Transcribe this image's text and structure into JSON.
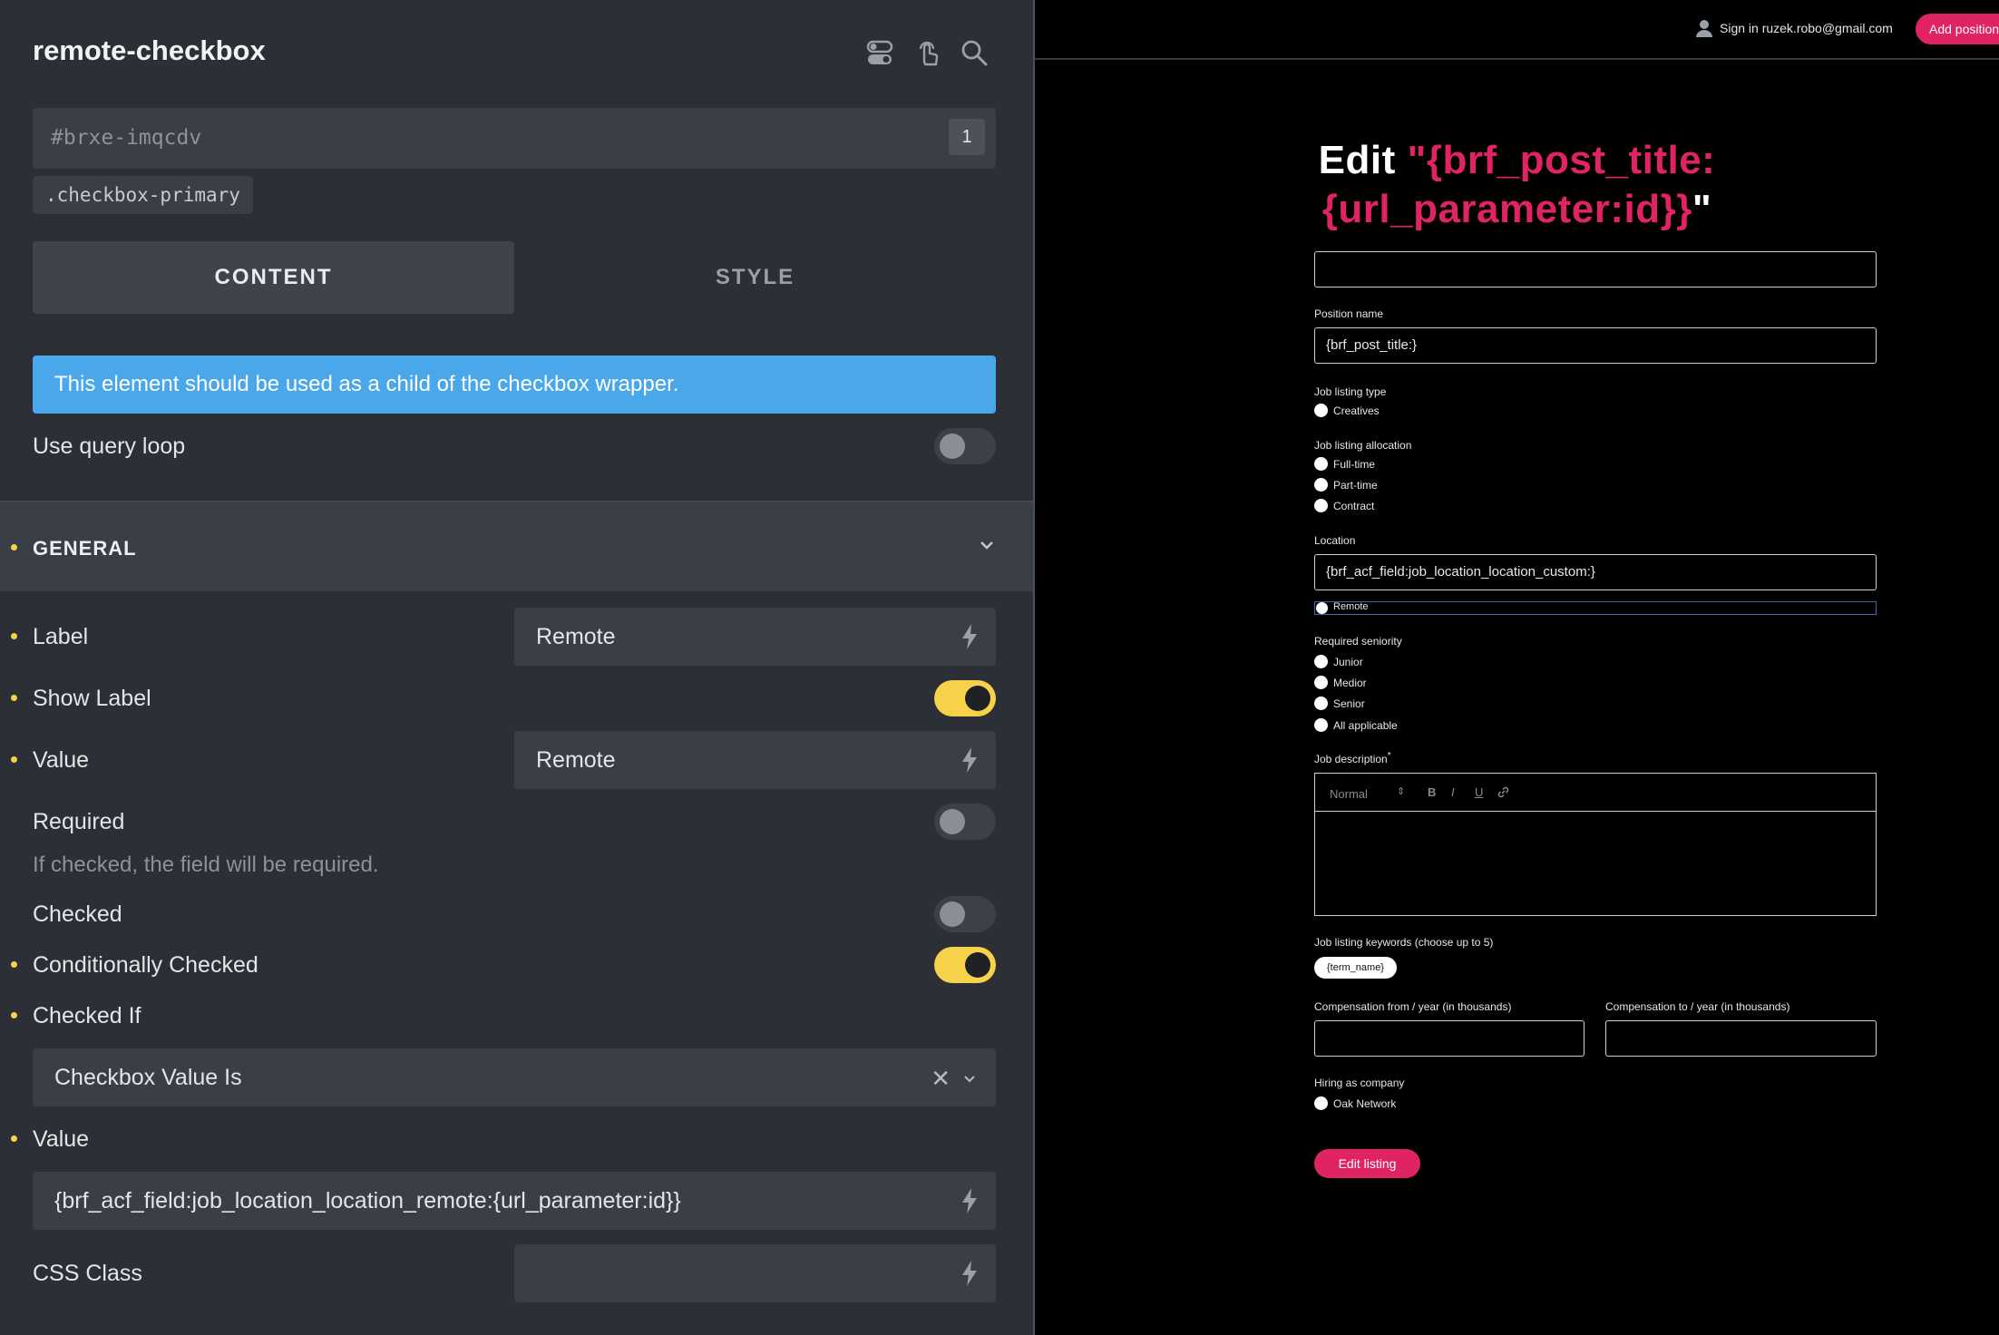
{
  "panel": {
    "title": "remote-checkbox",
    "element_id": "#brxe-imqcdv",
    "id_count": "1",
    "class_chip": ".checkbox-primary",
    "tabs": {
      "content": "CONTENT",
      "style": "STYLE"
    },
    "notice": "This element should be used as a child of the checkbox wrapper.",
    "use_query_loop": "Use query loop",
    "general_title": "GENERAL",
    "label_label": "Label",
    "label_value": "Remote",
    "show_label": "Show Label",
    "value_label": "Value",
    "value_value": "Remote",
    "required_label": "Required",
    "required_hint": "If checked, the field will be required.",
    "checked_label": "Checked",
    "cond_checked_label": "Conditionally Checked",
    "checked_if_label": "Checked If",
    "checked_if_value": "Checkbox Value Is",
    "value2_label": "Value",
    "value2_value": "{brf_acf_field:job_location_location_remote:{url_parameter:id}}",
    "css_class_label": "CSS Class",
    "css_class_value": "",
    "toggles": {
      "use_query_loop": false,
      "show_label": true,
      "required": false,
      "checked": false,
      "conditionally_checked": true
    },
    "accent_color": "#f6d24a",
    "notice_color": "#4aa8ea"
  },
  "preview": {
    "signin": "Sign in ruzek.robo@gmail.com",
    "add_button": "Add position",
    "headline_white": "Edit ",
    "headline_pink_1": "\"{brf_post_title:",
    "headline_pink_2": "{url_parameter:id}}",
    "headline_white_end": "\"",
    "position_name_label": "Position name",
    "position_name_value": "{brf_post_title:}",
    "job_type_label": "Job listing type",
    "job_type_options": [
      "Creatives"
    ],
    "allocation_label": "Job listing allocation",
    "allocation_options": [
      "Full-time",
      "Part-time",
      "Contract"
    ],
    "location_label": "Location",
    "location_value": "{brf_acf_field:job_location_location_custom:}",
    "remote_label": "Remote",
    "seniority_label": "Required seniority",
    "seniority_options": [
      "Junior",
      "Medior",
      "Senior",
      "All applicable"
    ],
    "description_label": "Job description",
    "required_mark": "*",
    "editor_format": "Normal",
    "editor_buttons": [
      "B",
      "I",
      "U"
    ],
    "keywords_label": "Job listing keywords (choose up to 5)",
    "keyword_chip": "{term_name}",
    "comp_from_label": "Compensation from / year (in thousands)",
    "comp_to_label": "Compensation to / year (in thousands)",
    "company_label": "Hiring as company",
    "company_options": [
      "Oak Network"
    ],
    "submit_label": "Edit listing",
    "brand_color": "#e02463"
  }
}
